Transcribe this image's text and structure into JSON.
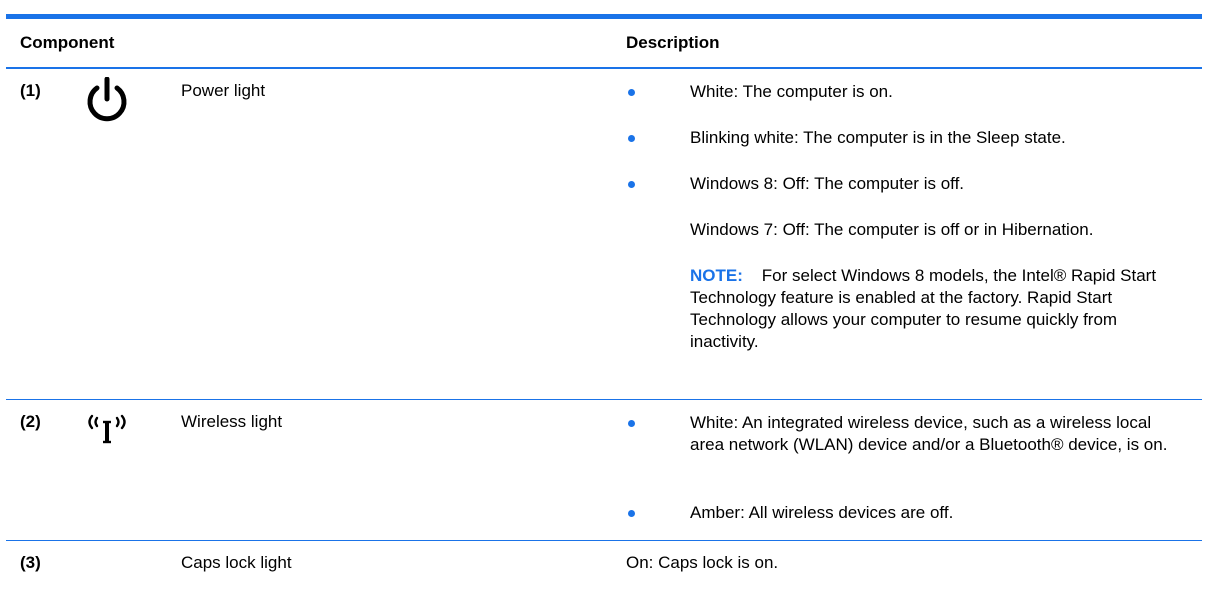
{
  "table": {
    "headers": {
      "component": "Component",
      "description": "Description"
    },
    "rows": [
      {
        "number": "(1)",
        "icon": "power-icon",
        "label": "Power light",
        "bullets": [
          "White: The computer is on.",
          "Blinking white: The computer is in the Sleep state.",
          "Windows 8: Off: The computer is off."
        ],
        "extra": "Windows 7: Off: The computer is off or in Hibernation.",
        "note_label": "NOTE:",
        "note_text": "For select Windows 8 models, the Intel® Rapid Start Technology feature is enabled at the factory. Rapid Start Technology allows your computer to resume quickly from inactivity."
      },
      {
        "number": "(2)",
        "icon": "wireless-icon",
        "label": "Wireless light",
        "bullets": [
          "White: An integrated wireless device, such as a wireless local area network (WLAN) device and/or a Bluetooth® device, is on.",
          "Amber: All wireless devices are off."
        ]
      },
      {
        "number": "(3)",
        "label": "Caps lock light",
        "description": "On: Caps lock is on."
      }
    ]
  },
  "colors": {
    "accent": "#1a73e8"
  }
}
